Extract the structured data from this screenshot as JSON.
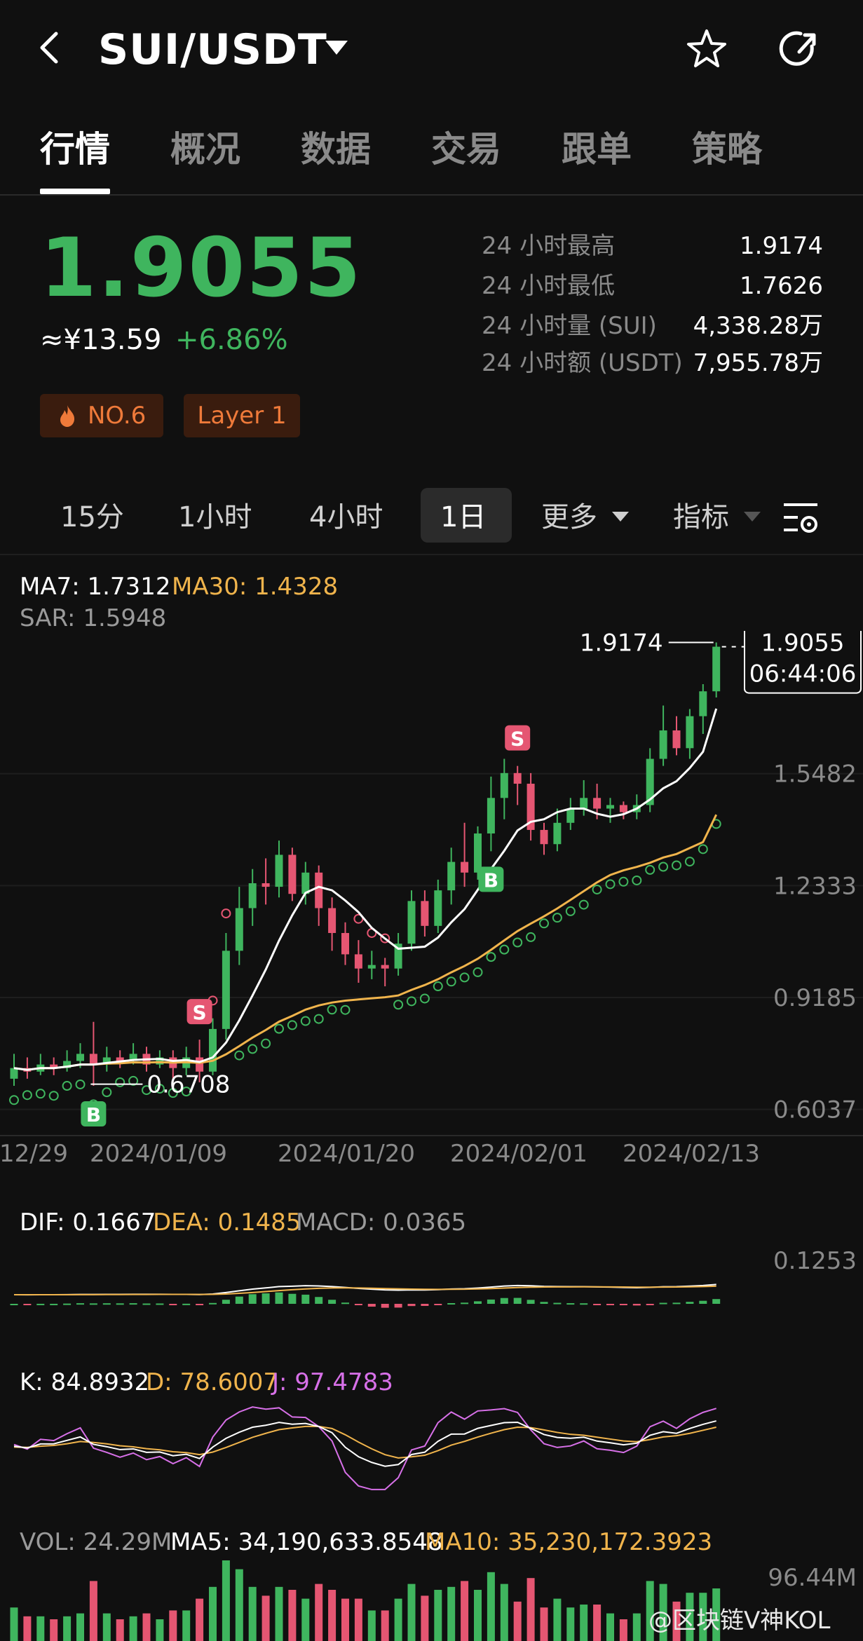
{
  "header": {
    "pair": "SUI/USDT"
  },
  "tabs": [
    "行情",
    "概况",
    "数据",
    "交易",
    "跟单",
    "策略"
  ],
  "price": {
    "last": "1.9055",
    "cny": "≈¥13.59",
    "change": "+6.86%",
    "rank_tag": "NO.6",
    "category_tag": "Layer 1"
  },
  "stats": [
    {
      "label": "24 小时最高",
      "value": "1.9174"
    },
    {
      "label": "24 小时最低",
      "value": "1.7626"
    },
    {
      "label": "24 小时量 (SUI)",
      "value": "4,338.28万"
    },
    {
      "label": "24 小时额 (USDT)",
      "value": "7,955.78万"
    }
  ],
  "timeframes": [
    "15分",
    "1小时",
    "4小时",
    "1日",
    "更多",
    "指标"
  ],
  "active_timeframe": "1日",
  "colors": {
    "up": "#3fb55e",
    "down": "#e55672",
    "ma7": "#ffffff",
    "ma30": "#f0b44c",
    "sar_up": "#3fb55e",
    "sar_down": "#e55672",
    "j": "#d770e8",
    "tag_text": "#ef7a3a"
  },
  "main_legend": {
    "ma7": "MA7: 1.7312",
    "ma30": "MA30: 1.4328",
    "sar": "SAR: 1.5948"
  },
  "chart_data": {
    "type": "candlestick",
    "x_ticks": [
      "12/29",
      "2024/01/09",
      "2024/01/20",
      "2024/02/01",
      "2024/02/13"
    ],
    "y_ticks": [
      "1.5482",
      "1.2333",
      "0.9185",
      "0.6037"
    ],
    "y_tick_values": [
      1.5482,
      1.2333,
      0.9185,
      0.6037
    ],
    "y_range": [
      0.53,
      1.95
    ],
    "high_marker": "1.9174",
    "low_marker": "0.6708",
    "last_price_box": {
      "price": "1.9055",
      "countdown": "06:44:06"
    },
    "signals": [
      {
        "type": "B",
        "index": 6
      },
      {
        "type": "S",
        "index": 14
      },
      {
        "type": "S",
        "index": 38
      },
      {
        "type": "B",
        "index": 36
      }
    ],
    "candles": [
      [
        0.69,
        0.72,
        0.76,
        0.67
      ],
      [
        0.72,
        0.71,
        0.75,
        0.69
      ],
      [
        0.71,
        0.73,
        0.76,
        0.7
      ],
      [
        0.73,
        0.72,
        0.75,
        0.7
      ],
      [
        0.72,
        0.74,
        0.77,
        0.71
      ],
      [
        0.74,
        0.76,
        0.79,
        0.72
      ],
      [
        0.76,
        0.73,
        0.85,
        0.67
      ],
      [
        0.73,
        0.75,
        0.78,
        0.71
      ],
      [
        0.75,
        0.74,
        0.77,
        0.72
      ],
      [
        0.74,
        0.76,
        0.79,
        0.73
      ],
      [
        0.76,
        0.73,
        0.78,
        0.71
      ],
      [
        0.73,
        0.75,
        0.77,
        0.72
      ],
      [
        0.75,
        0.72,
        0.77,
        0.69
      ],
      [
        0.72,
        0.75,
        0.78,
        0.7
      ],
      [
        0.75,
        0.71,
        0.8,
        0.68
      ],
      [
        0.71,
        0.83,
        0.86,
        0.7
      ],
      [
        0.83,
        1.05,
        1.1,
        0.8
      ],
      [
        1.05,
        1.17,
        1.23,
        1.01
      ],
      [
        1.17,
        1.24,
        1.28,
        1.12
      ],
      [
        1.24,
        1.23,
        1.31,
        1.18
      ],
      [
        1.23,
        1.32,
        1.36,
        1.2
      ],
      [
        1.32,
        1.21,
        1.34,
        1.19
      ],
      [
        1.21,
        1.27,
        1.3,
        1.18
      ],
      [
        1.27,
        1.17,
        1.29,
        1.12
      ],
      [
        1.17,
        1.1,
        1.2,
        1.05
      ],
      [
        1.1,
        1.04,
        1.13,
        1.01
      ],
      [
        1.04,
        1.0,
        1.08,
        0.96
      ],
      [
        1.0,
        1.01,
        1.05,
        0.97
      ],
      [
        1.01,
        1.0,
        1.03,
        0.95
      ],
      [
        1.0,
        1.07,
        1.1,
        0.98
      ],
      [
        1.07,
        1.19,
        1.22,
        1.05
      ],
      [
        1.19,
        1.12,
        1.22,
        1.09
      ],
      [
        1.12,
        1.22,
        1.25,
        1.1
      ],
      [
        1.22,
        1.3,
        1.34,
        1.18
      ],
      [
        1.3,
        1.27,
        1.41,
        1.23
      ],
      [
        1.27,
        1.38,
        1.4,
        1.25
      ],
      [
        1.38,
        1.48,
        1.54,
        1.33
      ],
      [
        1.48,
        1.55,
        1.59,
        1.42
      ],
      [
        1.55,
        1.52,
        1.57,
        1.46
      ],
      [
        1.52,
        1.39,
        1.55,
        1.36
      ],
      [
        1.39,
        1.35,
        1.41,
        1.32
      ],
      [
        1.35,
        1.41,
        1.45,
        1.33
      ],
      [
        1.41,
        1.45,
        1.48,
        1.39
      ],
      [
        1.45,
        1.48,
        1.53,
        1.43
      ],
      [
        1.48,
        1.45,
        1.52,
        1.42
      ],
      [
        1.45,
        1.46,
        1.48,
        1.41
      ],
      [
        1.46,
        1.44,
        1.47,
        1.42
      ],
      [
        1.44,
        1.46,
        1.49,
        1.42
      ],
      [
        1.46,
        1.59,
        1.62,
        1.44
      ],
      [
        1.59,
        1.67,
        1.74,
        1.57
      ],
      [
        1.67,
        1.62,
        1.71,
        1.6
      ],
      [
        1.62,
        1.71,
        1.73,
        1.59
      ],
      [
        1.71,
        1.78,
        1.8,
        1.66
      ],
      [
        1.78,
        1.9055,
        1.9174,
        1.7626
      ]
    ],
    "ma7_last": 1.7312,
    "ma30_last": 1.4328,
    "sar_last": 1.5948
  },
  "macd": {
    "dif": "DIF: 0.1667",
    "dea": "DEA: 0.1485",
    "macd": "MACD: 0.0365",
    "y_tick": "0.1253"
  },
  "kdj": {
    "k": "K: 84.8932",
    "d": "D: 78.6007",
    "j": "J: 97.4783"
  },
  "volume": {
    "vol": "VOL: 24.29M",
    "ma5": "MA5: 34,190,633.8548",
    "ma10": "MA10: 35,230,172.3923",
    "y_tick": "96.44M"
  },
  "watermark": "@区块链V神KOL"
}
